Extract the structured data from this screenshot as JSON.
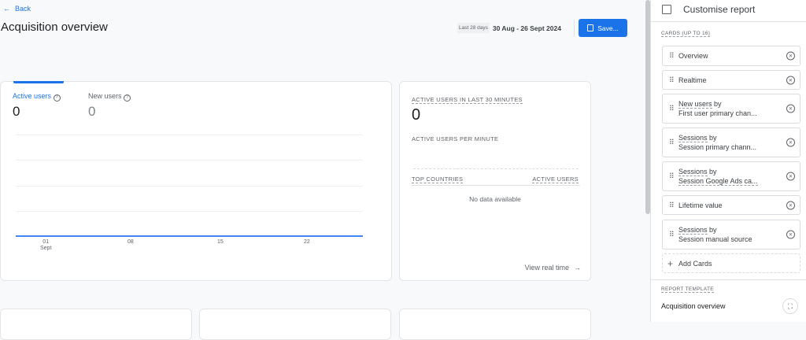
{
  "header": {
    "back_label": "Back",
    "title": "Acquisition overview",
    "date_range_label": "Last 28 days",
    "date_range": "30 Aug - 26 Sept 2024",
    "save_label": "Save..."
  },
  "overview_card": {
    "metrics": [
      {
        "label": "Active users",
        "value": "0"
      },
      {
        "label": "New users",
        "value": "0"
      }
    ],
    "x_ticks": [
      "01",
      "08",
      "15",
      "22"
    ],
    "x_tick_sub": "Sept"
  },
  "realtime_card": {
    "title": "ACTIVE USERS IN LAST 30 MINUTES",
    "value": "0",
    "per_minute": "ACTIVE USERS PER MINUTE",
    "col_left": "TOP COUNTRIES",
    "col_right": "ACTIVE USERS",
    "empty": "No data available",
    "link": "View real time"
  },
  "panel": {
    "title": "Customise report",
    "cards_heading": "CARDS (UP TO 16)",
    "cards": [
      {
        "line1": "Overview"
      },
      {
        "line1": "Realtime"
      },
      {
        "metric": "New users",
        "by": " by",
        "line2": "First user primary chan..."
      },
      {
        "metric": "Sessions",
        "by": " by",
        "line2": "Session primary chann..."
      },
      {
        "metric": "Sessions",
        "by": " by",
        "line2": "Session Google Ads ca..."
      },
      {
        "line1": "Lifetime value"
      },
      {
        "metric": "Sessions",
        "by": " by",
        "line2": "Session manual source"
      }
    ],
    "add_cards": "Add Cards",
    "template_heading": "REPORT TEMPLATE",
    "template_name": "Acquisition overview"
  },
  "colors": {
    "accent": "#1a73e8",
    "line": "#4285f4"
  }
}
